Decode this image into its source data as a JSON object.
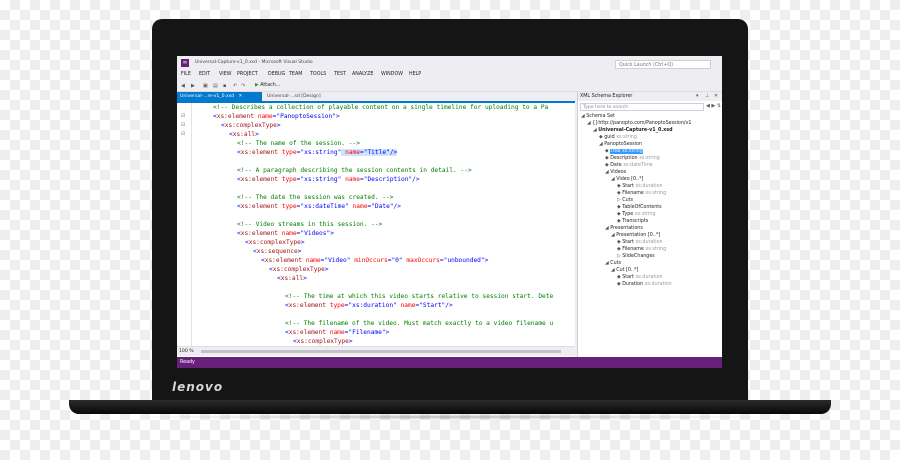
{
  "laptop": {
    "brand": "lenovo"
  },
  "window": {
    "title": "Universal-Capture-v1_0.xsd - Microsoft Visual Studio",
    "quick_launch_placeholder": "Quick Launch (Ctrl+Q)"
  },
  "menu": [
    "FILE",
    "EDIT",
    "VIEW",
    "PROJECT",
    "DEBUG",
    "TEAM",
    "TOOLS",
    "TEST",
    "ANALYZE",
    "WINDOW",
    "HELP"
  ],
  "toolbar": {
    "attach_label": "Attach..."
  },
  "editor": {
    "tabs": [
      {
        "label": "Universal-...re-v1_0.xsd"
      },
      {
        "label": "Universal-...sd [Design]"
      }
    ],
    "zoom": "100 %",
    "lines": [
      {
        "indent": 2,
        "text": "<!-- Describes a collection of playable content on a single timeline for uploading to a Pa"
      },
      {
        "indent": 2,
        "text": "<xs:element name=\"PanoptoSession\">"
      },
      {
        "indent": 3,
        "text": "<xs:complexType>"
      },
      {
        "indent": 4,
        "text": "<xs:all>"
      },
      {
        "indent": 5,
        "text": "<!-- The name of the session. -->"
      },
      {
        "indent": 5,
        "text": "<xs:element type=\"xs:string\" name=\"Title\"/>",
        "highlight": true
      },
      {
        "indent": 0,
        "text": ""
      },
      {
        "indent": 5,
        "text": "<!-- A paragraph describing the session contents in detail. -->"
      },
      {
        "indent": 5,
        "text": "<xs:element type=\"xs:string\" name=\"Description\"/>"
      },
      {
        "indent": 0,
        "text": ""
      },
      {
        "indent": 5,
        "text": "<!-- The date the session was created. -->"
      },
      {
        "indent": 5,
        "text": "<xs:element type=\"xs:dateTime\" name=\"Date\"/>"
      },
      {
        "indent": 0,
        "text": ""
      },
      {
        "indent": 5,
        "text": "<!-- Video streams in this session. -->"
      },
      {
        "indent": 5,
        "text": "<xs:element name=\"Videos\">"
      },
      {
        "indent": 6,
        "text": "<xs:complexType>"
      },
      {
        "indent": 7,
        "text": "<xs:sequence>"
      },
      {
        "indent": 8,
        "text": "<xs:element name=\"Video\" minOccurs=\"0\" maxOccurs=\"unbounded\">"
      },
      {
        "indent": 9,
        "text": "<xs:complexType>"
      },
      {
        "indent": 10,
        "text": "<xs:all>"
      },
      {
        "indent": 0,
        "text": ""
      },
      {
        "indent": 11,
        "text": "<!-- The time at which this video starts relative to session start. Dete"
      },
      {
        "indent": 11,
        "text": "<xs:element type=\"xs:duration\" name=\"Start\"/>"
      },
      {
        "indent": 0,
        "text": ""
      },
      {
        "indent": 11,
        "text": "<!-- The filename of the video. Must match exactly to a video filename u"
      },
      {
        "indent": 11,
        "text": "<xs:element name=\"Filename\">"
      },
      {
        "indent": 12,
        "text": "<xs:complexType>"
      }
    ]
  },
  "schema_explorer": {
    "title": "XML Schema Explorer",
    "search_placeholder": "Type here to search",
    "nodes": [
      {
        "level": 0,
        "twisty": "◢",
        "label": "Schema Set",
        "type": ""
      },
      {
        "level": 1,
        "twisty": "◢",
        "label": "{}http://panopto.com/PanoptoSession/v1",
        "type": ""
      },
      {
        "level": 2,
        "twisty": "◢",
        "label": "Universal-Capture-v1_0.xsd",
        "type": "",
        "bold": true
      },
      {
        "level": 3,
        "twisty": "",
        "label": "guid",
        "type": "xs:string"
      },
      {
        "level": 3,
        "twisty": "◢",
        "label": "PanoptoSession",
        "type": ""
      },
      {
        "level": 4,
        "twisty": "",
        "label": "Title",
        "type": "xs:string",
        "selected": true
      },
      {
        "level": 4,
        "twisty": "",
        "label": "Description",
        "type": "xs:string"
      },
      {
        "level": 4,
        "twisty": "",
        "label": "Date",
        "type": "xs:dateTime"
      },
      {
        "level": 4,
        "twisty": "◢",
        "label": "Videos",
        "type": ""
      },
      {
        "level": 5,
        "twisty": "◢",
        "label": "Video [0..*]",
        "type": ""
      },
      {
        "level": 6,
        "twisty": "",
        "label": "Start",
        "type": "xs:duration"
      },
      {
        "level": 6,
        "twisty": "",
        "label": "Filename",
        "type": "xs:string"
      },
      {
        "level": 6,
        "twisty": "▷",
        "label": "Cuts",
        "type": ""
      },
      {
        "level": 6,
        "twisty": "",
        "label": "TableOfContents",
        "type": ""
      },
      {
        "level": 6,
        "twisty": "",
        "label": "Type",
        "type": "xs:string"
      },
      {
        "level": 6,
        "twisty": "",
        "label": "Transcripts",
        "type": ""
      },
      {
        "level": 4,
        "twisty": "◢",
        "label": "Presentations",
        "type": ""
      },
      {
        "level": 5,
        "twisty": "◢",
        "label": "Presentation [0..*]",
        "type": ""
      },
      {
        "level": 6,
        "twisty": "",
        "label": "Start",
        "type": "xs:duration"
      },
      {
        "level": 6,
        "twisty": "",
        "label": "Filename",
        "type": "xs:string"
      },
      {
        "level": 6,
        "twisty": "▷",
        "label": "SlideChanges",
        "type": ""
      },
      {
        "level": 4,
        "twisty": "◢",
        "label": "Cuts",
        "type": ""
      },
      {
        "level": 5,
        "twisty": "◢",
        "label": "Cut [0..*]",
        "type": ""
      },
      {
        "level": 6,
        "twisty": "",
        "label": "Start",
        "type": "xs:duration"
      },
      {
        "level": 6,
        "twisty": "",
        "label": "Duration",
        "type": "xs:duration"
      }
    ]
  },
  "status": {
    "text": "Ready"
  },
  "colors": {
    "accent": "#007acc",
    "status_bar": "#68217a",
    "selection": "#3399ff"
  }
}
